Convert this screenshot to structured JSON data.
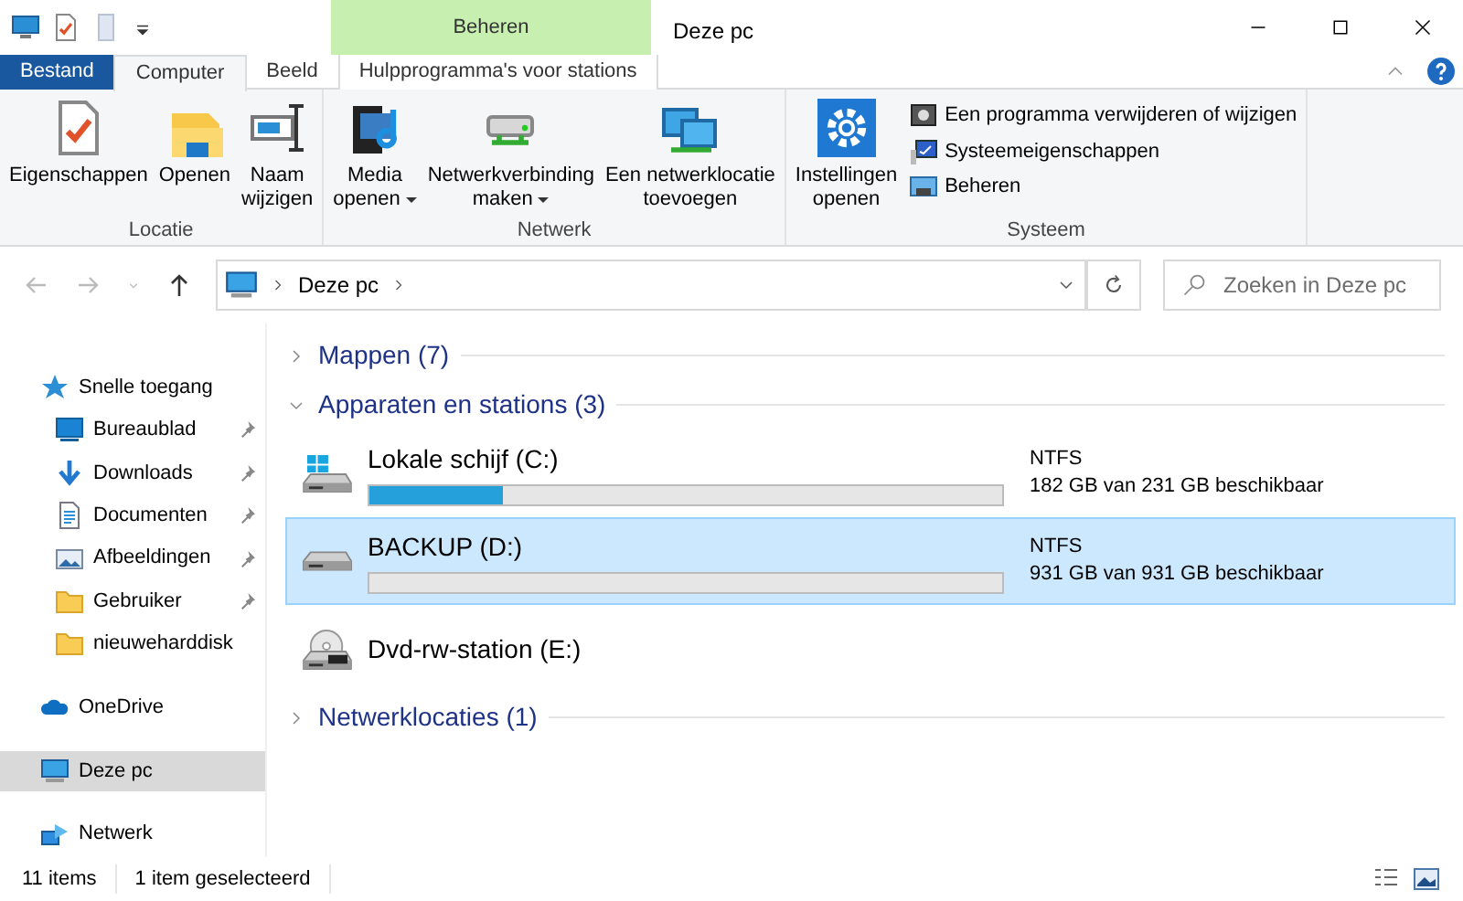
{
  "window": {
    "title": "Deze pc"
  },
  "context_group": {
    "label": "Beheren"
  },
  "tabs": [
    {
      "label": "Bestand",
      "kind": "file",
      "selected": false
    },
    {
      "label": "Computer",
      "kind": "tab",
      "selected": true
    },
    {
      "label": "Beeld",
      "kind": "tab",
      "selected": false
    },
    {
      "label": "Hulpprogramma's voor stations",
      "kind": "context",
      "selected": false
    }
  ],
  "ribbon": {
    "groups": [
      {
        "label": "Locatie",
        "items": [
          {
            "kind": "large",
            "lines": [
              "Eigenschappen"
            ],
            "has_menu": false
          },
          {
            "kind": "large",
            "lines": [
              "Openen"
            ],
            "has_menu": false
          },
          {
            "kind": "large",
            "lines": [
              "Naam",
              "wijzigen"
            ],
            "has_menu": false
          }
        ]
      },
      {
        "label": "Netwerk",
        "items": [
          {
            "kind": "large",
            "lines": [
              "Media",
              "openen"
            ],
            "has_menu": true
          },
          {
            "kind": "large",
            "lines": [
              "Netwerkverbinding",
              "maken"
            ],
            "has_menu": true
          },
          {
            "kind": "large",
            "lines": [
              "Een netwerklocatie",
              "toevoegen"
            ],
            "has_menu": false
          }
        ]
      },
      {
        "label": "Systeem",
        "items": [
          {
            "kind": "large",
            "lines": [
              "Instellingen",
              "openen"
            ],
            "has_menu": false
          },
          {
            "kind": "small",
            "lines": [
              "Een programma verwijderen of wijzigen"
            ],
            "has_menu": false
          },
          {
            "kind": "small",
            "lines": [
              "Systeemeigenschappen"
            ],
            "has_menu": false
          },
          {
            "kind": "small",
            "lines": [
              "Beheren"
            ],
            "has_menu": false
          }
        ]
      }
    ]
  },
  "address": {
    "path": [
      "Deze pc"
    ]
  },
  "search": {
    "placeholder": "Zoeken in Deze pc"
  },
  "navigation": [
    {
      "label": "Snelle toegang",
      "selected": false,
      "children": [
        {
          "label": "Bureaublad",
          "pinned": true,
          "selected": false
        },
        {
          "label": "Downloads",
          "pinned": true,
          "selected": false
        },
        {
          "label": "Documenten",
          "pinned": true,
          "selected": false
        },
        {
          "label": "Afbeeldingen",
          "pinned": true,
          "selected": false
        },
        {
          "label": "Gebruiker",
          "pinned": true,
          "selected": false
        },
        {
          "label": "nieuweharddisk",
          "pinned": false,
          "selected": false
        }
      ]
    },
    {
      "label": "OneDrive",
      "selected": false
    },
    {
      "label": "Deze pc",
      "selected": true
    },
    {
      "label": "Netwerk",
      "selected": false
    }
  ],
  "sections": [
    {
      "title": "Mappen (7)",
      "expanded": false
    },
    {
      "title": "Apparaten en stations (3)",
      "expanded": true,
      "drives": [
        {
          "name": "Lokale schijf (C:)",
          "kind": "system",
          "selected": false,
          "level": 0.21,
          "filesystem": "NTFS",
          "free": "182 GB van 231 GB beschikbaar"
        },
        {
          "name": "BACKUP (D:)",
          "kind": "hdd",
          "selected": true,
          "level": 0.0,
          "filesystem": "NTFS",
          "free": "931 GB van 931 GB beschikbaar"
        },
        {
          "name": "Dvd-rw-station (E:)",
          "kind": "dvd",
          "selected": false
        }
      ]
    },
    {
      "title": "Netwerklocaties (1)",
      "expanded": false
    }
  ],
  "status_bar": [
    "11 items",
    "1 item geselecteerd"
  ]
}
